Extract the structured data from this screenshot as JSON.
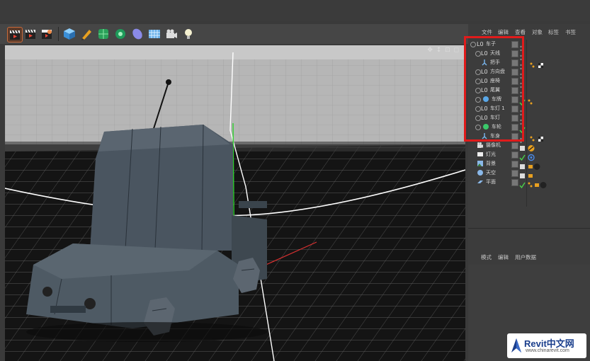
{
  "viewport": {
    "nav_icons": "✥ ↕ ⊡ ◻"
  },
  "menu": {
    "items": [
      "文件",
      "编辑",
      "查看",
      "对象",
      "标签",
      "书签"
    ]
  },
  "objects": [
    {
      "label": "车子",
      "type": "null",
      "depth": 0
    },
    {
      "label": "天线",
      "type": "null",
      "depth": 1
    },
    {
      "label": "把手",
      "type": "bone",
      "depth": 1
    },
    {
      "label": "方向盘",
      "type": "null",
      "depth": 1
    },
    {
      "label": "座椅",
      "type": "null",
      "depth": 1
    },
    {
      "label": "尾翼",
      "type": "null",
      "depth": 1
    },
    {
      "label": "车牌",
      "type": "sphere",
      "depth": 1
    },
    {
      "label": "车灯 1",
      "type": "null",
      "depth": 1
    },
    {
      "label": "车灯",
      "type": "null",
      "depth": 1
    },
    {
      "label": "车轮",
      "type": "green",
      "depth": 1
    },
    {
      "label": "车身",
      "type": "bone",
      "depth": 1
    },
    {
      "label": "摄像机",
      "type": "camera",
      "depth": 0
    },
    {
      "label": "灯光",
      "type": "light",
      "depth": 0
    },
    {
      "label": "背景",
      "type": "bg",
      "depth": 0
    },
    {
      "label": "天空",
      "type": "sky",
      "depth": 0
    },
    {
      "label": "平面",
      "type": "plane",
      "depth": 0
    }
  ],
  "attributes": {
    "menu": [
      "模式",
      "编辑",
      "用户数据"
    ]
  },
  "watermark": {
    "title": "Revit中文网",
    "url": "www.chinarevit.com"
  },
  "colors": {
    "highlight_box": "#e01b1b",
    "logo_blue": "#1a3e8c"
  }
}
